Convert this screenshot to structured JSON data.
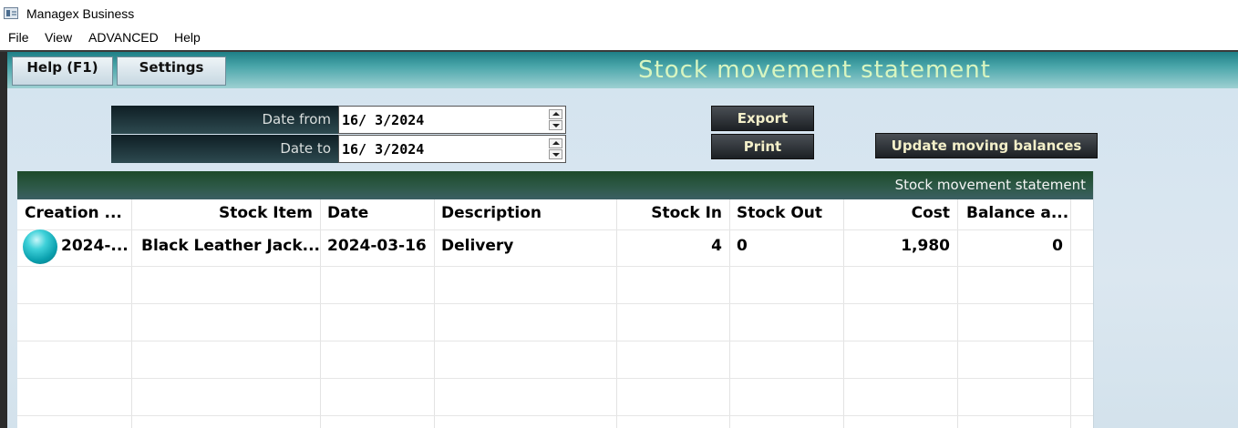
{
  "window": {
    "title": "Managex Business"
  },
  "menu": [
    "File",
    "View",
    "ADVANCED",
    "Help"
  ],
  "header": {
    "title": "Stock movement statement",
    "help_label": "Help (F1)",
    "settings_label": "Settings"
  },
  "filters": {
    "date_from_label": "Date from",
    "date_from_value": "16/  3/2024",
    "date_to_label": "Date to",
    "date_to_value": "16/  3/2024"
  },
  "actions": {
    "export_label": "Export",
    "print_label": "Print",
    "update_label": "Update moving balances"
  },
  "grid": {
    "caption": "Stock movement statement",
    "columns": [
      "Creation ...",
      "Stock Item",
      "Date",
      "Description",
      "Stock In",
      "Stock Out",
      "Cost",
      "Balance a..."
    ],
    "rows": [
      [
        "2024-...",
        "Black Leather Jack...",
        "2024-03-16",
        "Delivery",
        "4",
        "0",
        "1,980",
        "0"
      ]
    ]
  },
  "colors": {
    "header_title": "#d8f5c0",
    "button_text": "#f3efc9",
    "grid_caption_bg": "#1d4a2a"
  },
  "icons": [
    "app-icon",
    "row-status-orb-icon",
    "spin-up-icon",
    "spin-down-icon"
  ]
}
